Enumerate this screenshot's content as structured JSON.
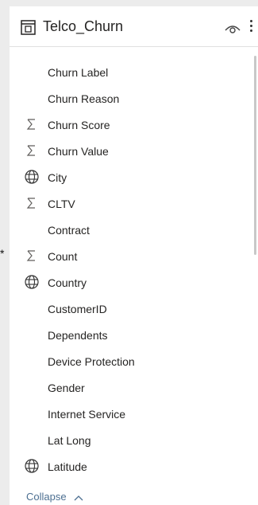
{
  "header": {
    "title": "Telco_Churn",
    "table_icon": "table-icon",
    "visibility_icon": "eye-icon",
    "more_icon": "more-options-icon"
  },
  "fields": [
    {
      "label": "Churn Label",
      "icon": "none"
    },
    {
      "label": "Churn Reason",
      "icon": "none"
    },
    {
      "label": "Churn Score",
      "icon": "sigma-icon"
    },
    {
      "label": "Churn Value",
      "icon": "sigma-icon"
    },
    {
      "label": "City",
      "icon": "globe-icon"
    },
    {
      "label": "CLTV",
      "icon": "sigma-icon"
    },
    {
      "label": "Contract",
      "icon": "none"
    },
    {
      "label": "Count",
      "icon": "sigma-icon"
    },
    {
      "label": "Country",
      "icon": "globe-icon"
    },
    {
      "label": "CustomerID",
      "icon": "none"
    },
    {
      "label": "Dependents",
      "icon": "none"
    },
    {
      "label": "Device Protection",
      "icon": "none"
    },
    {
      "label": "Gender",
      "icon": "none"
    },
    {
      "label": "Internet Service",
      "icon": "none"
    },
    {
      "label": "Lat Long",
      "icon": "none"
    },
    {
      "label": "Latitude",
      "icon": "globe-icon"
    }
  ],
  "left_marker": "*",
  "collapse": {
    "label": "Collapse",
    "icon": "chevron-up-icon"
  },
  "colors": {
    "panel_bg": "#ffffff",
    "page_bg": "#ececec",
    "text": "#252423",
    "link": "#4c6f91",
    "icon": "#605e5c"
  }
}
